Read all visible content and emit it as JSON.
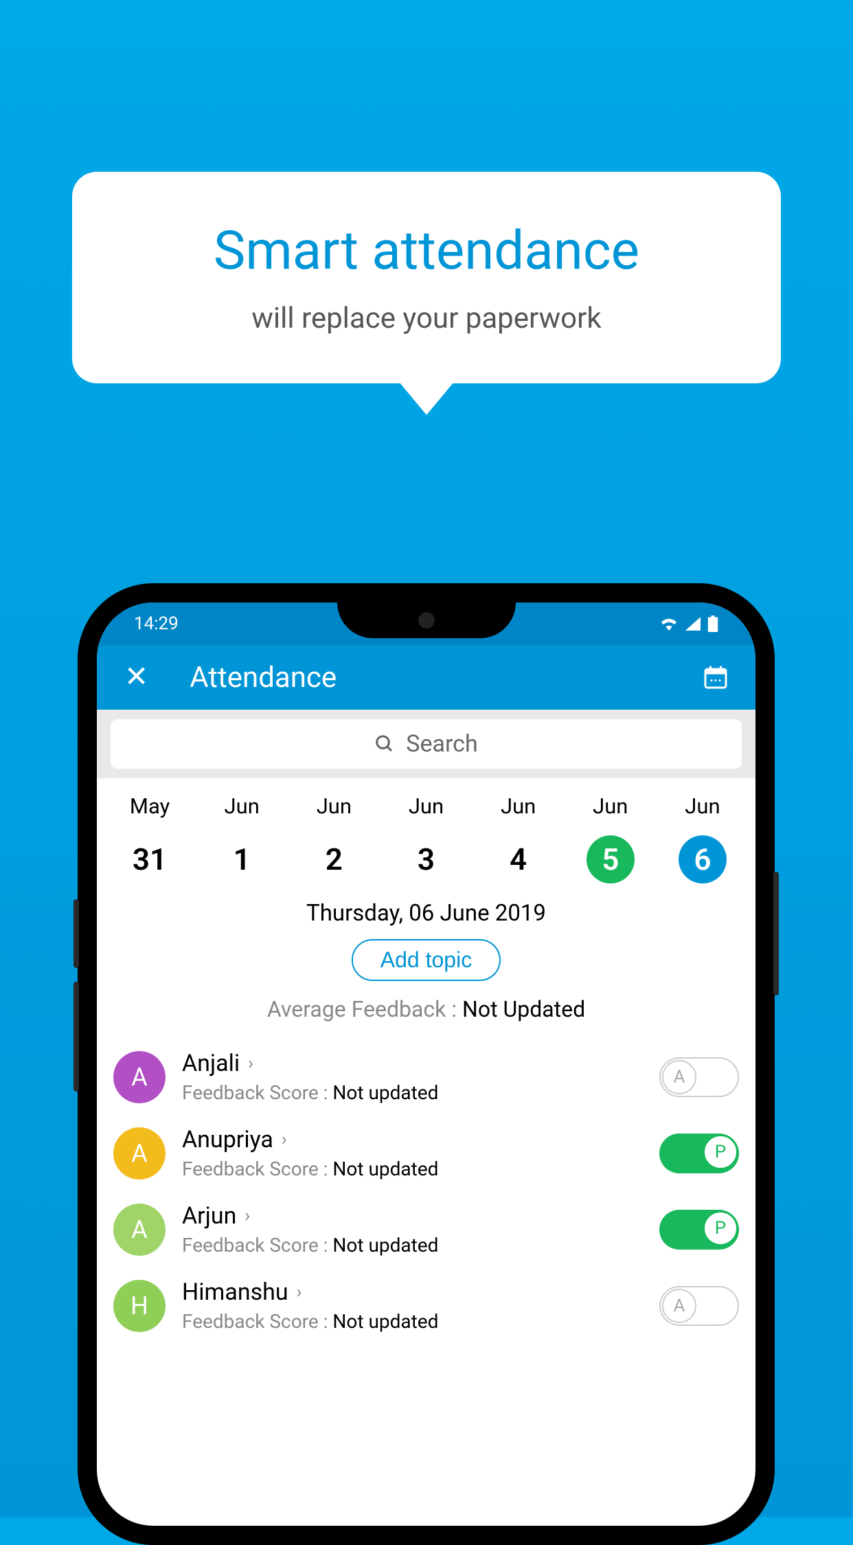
{
  "bubble": {
    "title": "Smart attendance",
    "subtitle": "will replace your paperwork"
  },
  "statusbar": {
    "time": "14:29"
  },
  "appbar": {
    "title": "Attendance"
  },
  "search": {
    "placeholder": "Search"
  },
  "dates": [
    {
      "month": "May",
      "day": "31",
      "style": ""
    },
    {
      "month": "Jun",
      "day": "1",
      "style": ""
    },
    {
      "month": "Jun",
      "day": "2",
      "style": ""
    },
    {
      "month": "Jun",
      "day": "3",
      "style": ""
    },
    {
      "month": "Jun",
      "day": "4",
      "style": ""
    },
    {
      "month": "Jun",
      "day": "5",
      "style": "green"
    },
    {
      "month": "Jun",
      "day": "6",
      "style": "blue"
    }
  ],
  "selectedDate": "Thursday, 06 June 2019",
  "addTopic": "Add topic",
  "avgFeedback": {
    "label": "Average Feedback : ",
    "value": "Not Updated"
  },
  "students": [
    {
      "name": "Anjali",
      "initial": "A",
      "color": "#b24fc4",
      "feedbackLabel": "Feedback Score : ",
      "feedbackValue": "Not updated",
      "present": false,
      "knob": "A"
    },
    {
      "name": "Anupriya",
      "initial": "A",
      "color": "#f4bb1d",
      "feedbackLabel": "Feedback Score : ",
      "feedbackValue": "Not updated",
      "present": true,
      "knob": "P"
    },
    {
      "name": "Arjun",
      "initial": "A",
      "color": "#a0d468",
      "feedbackLabel": "Feedback Score : ",
      "feedbackValue": "Not updated",
      "present": true,
      "knob": "P"
    },
    {
      "name": "Himanshu",
      "initial": "H",
      "color": "#8fce57",
      "feedbackLabel": "Feedback Score : ",
      "feedbackValue": "Not updated",
      "present": false,
      "knob": "A"
    }
  ]
}
